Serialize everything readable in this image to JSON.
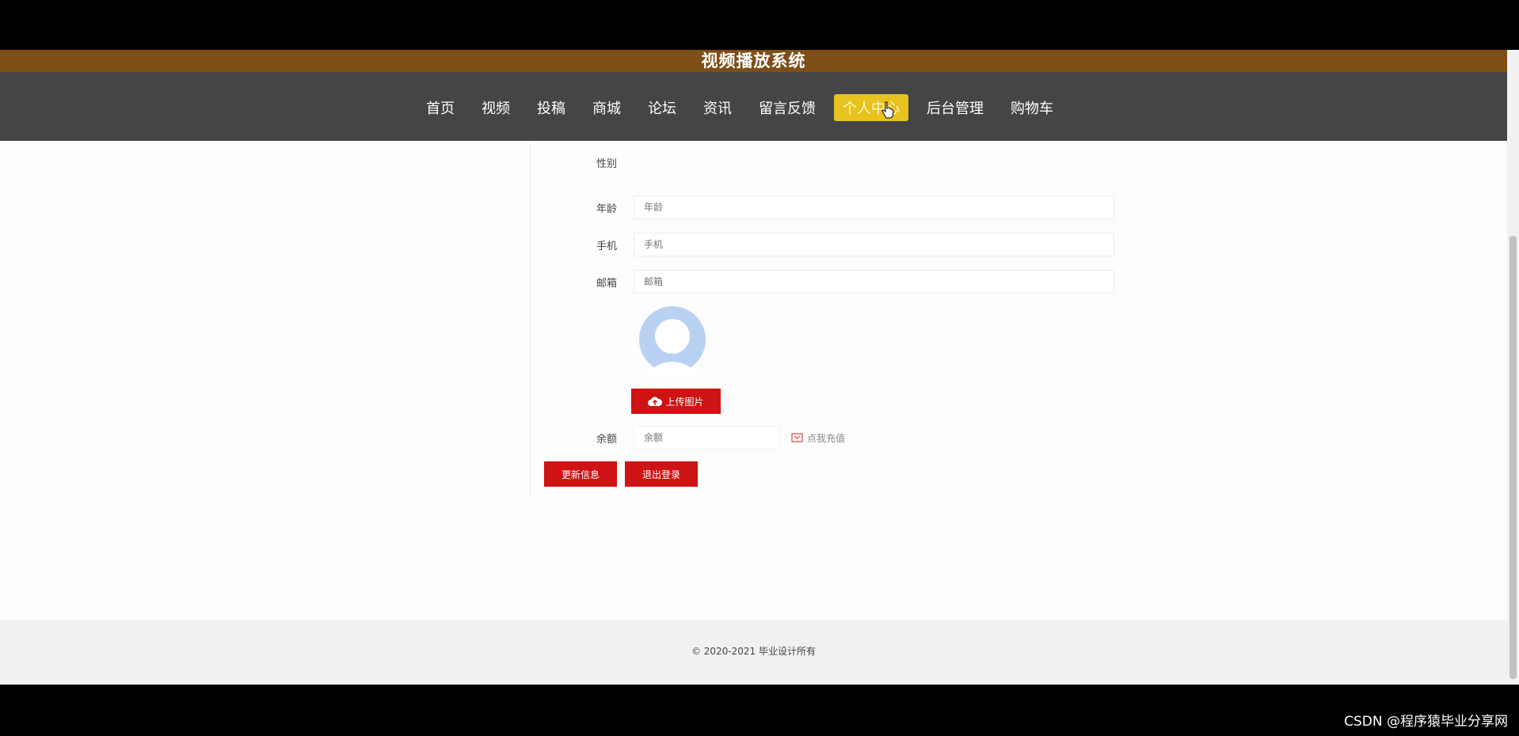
{
  "header": {
    "site_title": "视频播放系统"
  },
  "nav": {
    "items": [
      {
        "label": "首页"
      },
      {
        "label": "视频"
      },
      {
        "label": "投稿"
      },
      {
        "label": "商城"
      },
      {
        "label": "论坛"
      },
      {
        "label": "资讯"
      },
      {
        "label": "留言反馈"
      },
      {
        "label": "个人中心",
        "active": true
      },
      {
        "label": "后台管理"
      },
      {
        "label": "购物车"
      }
    ]
  },
  "form": {
    "gender_label": "性别",
    "age_label": "年龄",
    "age_placeholder": "年龄",
    "phone_label": "手机",
    "phone_placeholder": "手机",
    "email_label": "邮箱",
    "email_placeholder": "邮箱",
    "upload_label": "上传图片",
    "balance_label": "余额",
    "balance_placeholder": "余额",
    "recharge_label": "点我充值"
  },
  "actions": {
    "update_label": "更新信息",
    "logout_label": "退出登录"
  },
  "footer": {
    "copyright": "© 2020-2021 毕业设计所有"
  },
  "watermark": "CSDN @程序猿毕业分享网",
  "colors": {
    "title_bar": "#7d4e17",
    "nav_bar": "#454545",
    "active_nav": "#e8c21e",
    "button_red": "#cd1313"
  }
}
